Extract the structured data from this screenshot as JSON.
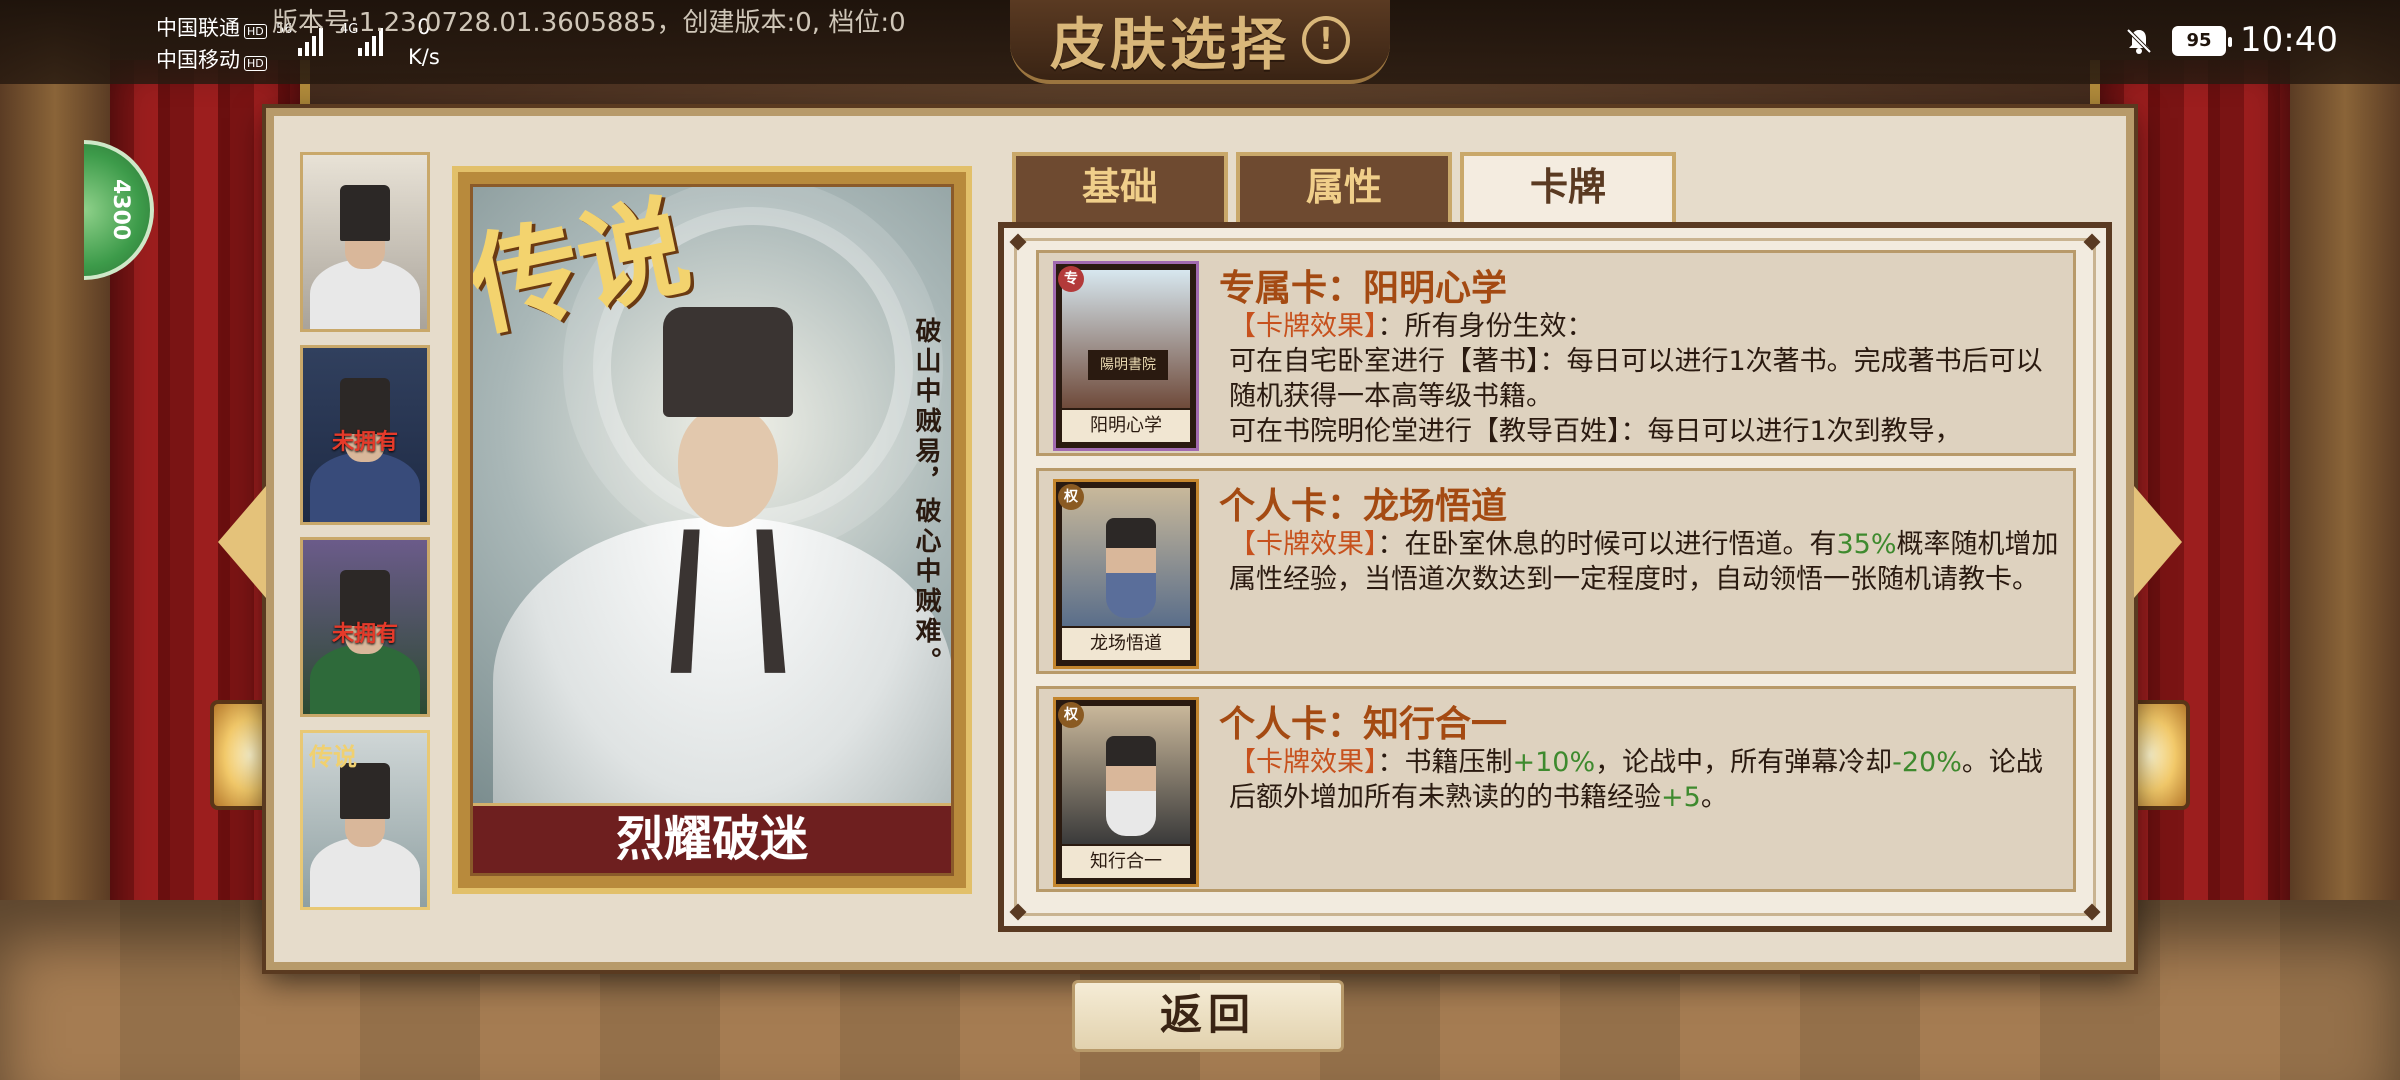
{
  "status_bar": {
    "carrier1": "中国联通",
    "carrier2": "中国移动",
    "hd": "HD",
    "net1": "56",
    "net2": "4G",
    "speed_value": "0",
    "speed_unit": "K/s",
    "version": "版本号:1.23.0728.01.3605885，创建版本:0, 档位:0",
    "battery": "95",
    "time": "10:40"
  },
  "header": {
    "title": "皮肤选择",
    "info_glyph": "!"
  },
  "side_badge": "4300",
  "skins": [
    {
      "status": ""
    },
    {
      "status": "未拥有"
    },
    {
      "status": "未拥有"
    },
    {
      "status": "",
      "legend_mark": "传说"
    }
  ],
  "featured_card": {
    "legend_mark": "传说",
    "poem": "破山中贼易，破心中贼难。",
    "name": "烈耀破迷"
  },
  "tabs": [
    "基础",
    "属性",
    "卡牌"
  ],
  "active_tab": "卡牌",
  "cards": [
    {
      "badge": "专",
      "mini_label": "阳明心学",
      "sign_text": "陽明書院",
      "title": "专属卡：阳明心学",
      "effect_label": "【卡牌效果】",
      "line1": "：所有身份生效：",
      "line2": "可在自宅卧室进行【著书】：每日可以进行1次著书。完成著书后可以随机获得一本高等级书籍。",
      "line3": "可在书院明伦堂进行【教导百姓】：每日可以进行1次到教导，"
    },
    {
      "badge": "权",
      "mini_label": "龙场悟道",
      "title": "个人卡：龙场悟道",
      "effect_label": "【卡牌效果】",
      "text_a": "：在卧室休息的时候可以进行悟道。有",
      "pct": "35%",
      "text_b": "概率随机增加属性经验，当悟道次数达到一定程度时，自动领悟一张随机请教卡。"
    },
    {
      "badge": "权",
      "mini_label": "知行合一",
      "title": "个人卡：知行合一",
      "effect_label": "【卡牌效果】",
      "text_a": "：书籍压制",
      "v1": "+10%",
      "text_b": "，论战中，所有弹幕冷却",
      "v2": "-20%",
      "text_c": "。论战后额外增加所有未熟读的的书籍经验",
      "v3": "+5",
      "text_d": "。"
    }
  ],
  "back_button": "返回",
  "colors": {
    "accent_gold": "#e2c06a",
    "title_brown": "#a44a12",
    "effect_orange": "#c7511d",
    "positive_green": "#3e8a2e",
    "not_owned_red": "#e53a2a"
  }
}
